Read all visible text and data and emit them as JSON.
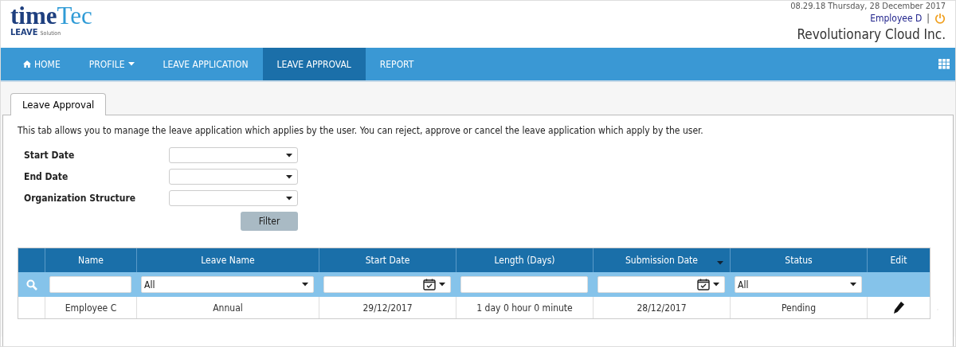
{
  "header": {
    "clock": "08.29.18 Thursday, 28 December 2017",
    "user": "Employee D",
    "separator": "|",
    "company": "Revolutionary Cloud Inc."
  },
  "logo": {
    "brand_left": "time",
    "brand_right": "Tec",
    "product": "LEAVE",
    "product_sub": "Solution"
  },
  "nav": [
    {
      "label": "HOME",
      "selected": false,
      "icon": true,
      "menu": false
    },
    {
      "label": "PROFILE",
      "selected": false,
      "icon": false,
      "menu": true
    },
    {
      "label": "LEAVE APPLICATION",
      "selected": false,
      "icon": false,
      "menu": false
    },
    {
      "label": "LEAVE APPROVAL",
      "selected": true,
      "icon": false,
      "menu": false
    },
    {
      "label": "REPORT",
      "selected": false,
      "icon": false,
      "menu": false
    }
  ],
  "tabs": [
    {
      "label": "Leave Approval",
      "selected": true
    }
  ],
  "description": "This tab allows you to manage the leave application which applies by the user. You can reject, approve or cancel the leave application which apply by the user.",
  "filters": [
    {
      "label": "Start Date"
    },
    {
      "label": "End Date"
    },
    {
      "label": "Organization Structure"
    }
  ],
  "filter_button": "Filter",
  "table": {
    "columns": [
      {
        "label": "Name",
        "sorted": false
      },
      {
        "label": "Leave Name",
        "sorted": false
      },
      {
        "label": "Start Date",
        "sorted": false
      },
      {
        "label": "Length (Days)",
        "sorted": false
      },
      {
        "label": "Submission Date",
        "sorted": true
      },
      {
        "label": "Status",
        "sorted": false
      },
      {
        "label": "Edit",
        "sorted": false
      }
    ],
    "filter_row": [
      {
        "kind": "text"
      },
      {
        "kind": "select",
        "value": "All"
      },
      {
        "kind": "date"
      },
      {
        "kind": "text"
      },
      {
        "kind": "date"
      },
      {
        "kind": "select",
        "value": "All"
      },
      {
        "kind": "none"
      }
    ],
    "rows": [
      {
        "cells": [
          "Employee C",
          "Annual",
          "29/12/2017",
          "1 day 0 hour 0 minute",
          "28/12/2017",
          "Pending"
        ]
      }
    ]
  }
}
